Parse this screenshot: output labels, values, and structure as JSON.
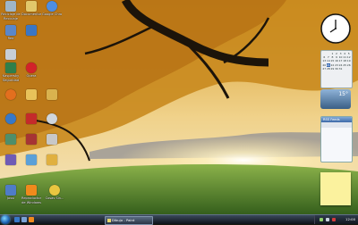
{
  "desktop_icons": [
    {
      "id": "recycle",
      "label": "Reciclaje de",
      "label2": "Reciclaje",
      "color": "#9fb6c8"
    },
    {
      "id": "mydocs",
      "label": "Documentos",
      "label2": "",
      "color": "#e2c86a"
    },
    {
      "id": "chrome",
      "label": "Google Chrome",
      "label2": "",
      "color": "#4d8ee3"
    },
    {
      "id": "network",
      "label": "Red",
      "label2": "",
      "color": "#5a87c9"
    },
    {
      "id": "mail",
      "label": "",
      "label2": "",
      "color": "#3a76c5"
    },
    {
      "id": "usb",
      "label": "",
      "label2": "",
      "color": "#c7ced6"
    },
    {
      "id": "av",
      "label": "Kaspersky",
      "label2": "Seguridad",
      "color": "#2f7f4a"
    },
    {
      "id": "opera",
      "label": "Opera",
      "label2": "",
      "color": "#d2232a"
    },
    {
      "id": "firefox",
      "label": "",
      "label2": "",
      "color": "#e36f1e"
    },
    {
      "id": "folder1",
      "label": "",
      "label2": "",
      "color": "#e8c25a"
    },
    {
      "id": "folder2",
      "label": "",
      "label2": "",
      "color": "#d9b24e"
    },
    {
      "id": "ie",
      "label": "",
      "label2": "",
      "color": "#3778c8"
    },
    {
      "id": "acrobat",
      "label": "",
      "label2": "",
      "color": "#c42b2b"
    },
    {
      "id": "cd",
      "label": "",
      "label2": "",
      "color": "#d0d6dc"
    },
    {
      "id": "media",
      "label": "",
      "label2": "",
      "color": "#4f8e6a"
    },
    {
      "id": "game1",
      "label": "",
      "label2": "",
      "color": "#a63434"
    },
    {
      "id": "game2",
      "label": "",
      "label2": "",
      "color": "#c8c8c8"
    },
    {
      "id": "tool1",
      "label": "",
      "label2": "",
      "color": "#6f5bb5"
    },
    {
      "id": "tool2",
      "label": "",
      "label2": "",
      "color": "#5aa0d8"
    },
    {
      "id": "tool3",
      "label": "",
      "label2": "",
      "color": "#e0b040"
    },
    {
      "id": "vista",
      "label": "Jossi",
      "label2": "",
      "color": "#4f7cc8"
    },
    {
      "id": "player",
      "label": "Reproductor",
      "label2": "de Windows",
      "color": "#f08a1c"
    },
    {
      "id": "cosas",
      "label": "Cosas Sin...",
      "label2": "",
      "color": "#e9c640"
    }
  ],
  "sidebar": {
    "calendar": {
      "month": "",
      "days": [
        "",
        "",
        "1",
        "2",
        "3",
        "4",
        "5",
        "6",
        "7",
        "8",
        "9",
        "10",
        "11",
        "12",
        "13",
        "14",
        "15",
        "16",
        "17",
        "18",
        "19",
        "20",
        "21",
        "22",
        "23",
        "24",
        "25",
        "26",
        "27",
        "28",
        "29",
        "30",
        "31",
        "",
        ""
      ],
      "today": "21"
    },
    "weather": {
      "temp": "15°",
      "city": ""
    },
    "feeds": {
      "title": "RSS Feeds",
      "items": [
        "",
        "",
        "",
        "",
        "",
        ""
      ]
    },
    "note": {
      "text": ""
    }
  },
  "taskbar": {
    "task_button": "Dibujo - Paint",
    "tray_time": "12:00"
  },
  "colors": {
    "accent": "#3b6db5",
    "taskbar": "#1b2430"
  }
}
